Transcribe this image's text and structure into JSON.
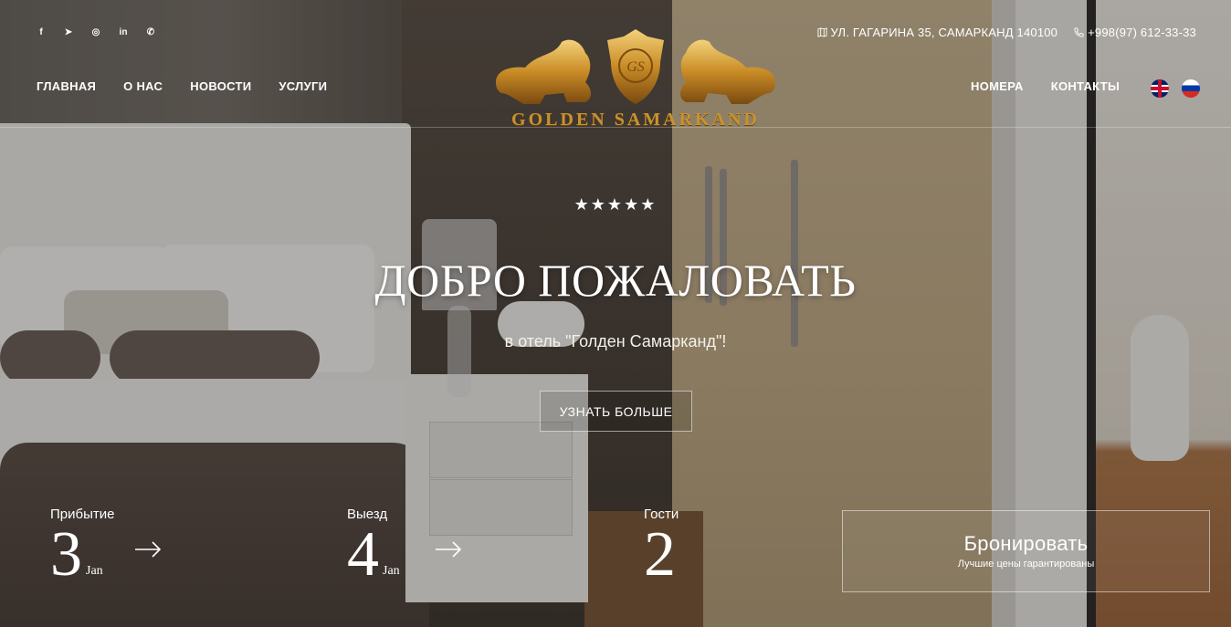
{
  "header": {
    "social_icons": [
      {
        "icon": "facebook-icon",
        "glyph": "f"
      },
      {
        "icon": "telegram-icon",
        "glyph": "➤"
      },
      {
        "icon": "instagram-icon",
        "glyph": "◎"
      },
      {
        "icon": "linkedin-icon",
        "glyph": "in"
      },
      {
        "icon": "whatsapp-icon",
        "glyph": "✆"
      }
    ],
    "address": "УЛ. ГАГАРИНА 35, САМАРКАНД 140100",
    "phone": "+998(97) 612-33-33",
    "nav_left": [
      "ГЛАВНАЯ",
      "О НАС",
      "НОВОСТИ",
      "УСЛУГИ"
    ],
    "nav_right": [
      "НОМЕРА",
      "КОНТАКТЫ"
    ],
    "languages": [
      "en",
      "ru"
    ],
    "logo_text": "GOLDEN SAMARKAND"
  },
  "hero": {
    "stars": "★★★★★",
    "title": "ДОБРО ПОЖАЛОВАТЬ",
    "subtitle": "в отель \"Голден Самарканд\"!",
    "button": "УЗНАТЬ БОЛЬШЕ"
  },
  "booking": {
    "arrival_label": "Прибытие",
    "arrival_day": "3",
    "arrival_month": "Jan",
    "departure_label": "Выезд",
    "departure_day": "4",
    "departure_month": "Jan",
    "guests_label": "Гости",
    "guests_count": "2",
    "book_button": "Бронировать",
    "book_note": "Лучшие цены гарантированы"
  },
  "colors": {
    "gold": "#c9922f",
    "text": "#ffffff"
  }
}
